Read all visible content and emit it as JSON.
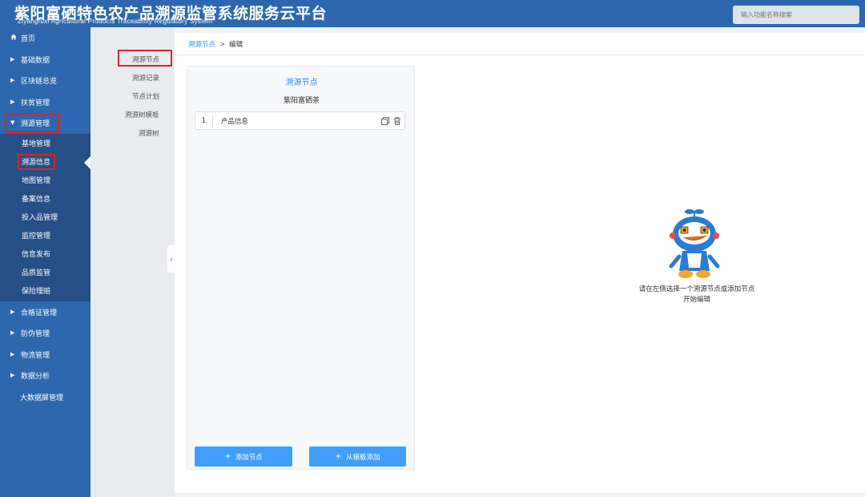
{
  "header": {
    "title": "紫阳富硒特色农产品溯源监管系统服务云平台",
    "subtitle": "Ziyangfuxi Agricultural Products Traceability Regulatory System",
    "search_placeholder": "输入功能名称搜索"
  },
  "sidebar": {
    "home": "首页",
    "items": [
      {
        "label": "基础数据"
      },
      {
        "label": "区块链总览"
      },
      {
        "label": "扶贫管理"
      },
      {
        "label": "溯源管理"
      }
    ],
    "submenu": [
      "基地管理",
      "溯源信息",
      "地图管理",
      "备案信息",
      "投入品管理",
      "监控管理",
      "信息发布",
      "品质监管",
      "保险理赔"
    ],
    "items_after": [
      {
        "label": "合格证管理"
      },
      {
        "label": "防伪管理"
      },
      {
        "label": "物流管理"
      },
      {
        "label": "数据分析"
      }
    ],
    "bigscreen": "大数据屏管理"
  },
  "sidebar2": {
    "items": [
      "溯源节点",
      "溯源记录",
      "节点计划",
      "溯源树模板",
      "溯源树"
    ]
  },
  "breadcrumb": {
    "parent": "溯源节点",
    "separator": ">",
    "current": "编辑"
  },
  "tree_panel": {
    "title": "溯源节点",
    "subtitle": "紫阳富硒茶",
    "nodes": [
      {
        "index": "1",
        "label": "产品信息"
      }
    ],
    "add_node_label": "添加节点",
    "add_from_template_label": "从模板添加"
  },
  "empty_state": {
    "line1": "请在左侧选择一个溯源节点或添加节点",
    "line2": "开始编辑"
  },
  "colors": {
    "header_bg": "#2e67ad",
    "submenu_bg": "#254f85",
    "accent": "#409eff",
    "highlight_box": "#d9232a"
  }
}
